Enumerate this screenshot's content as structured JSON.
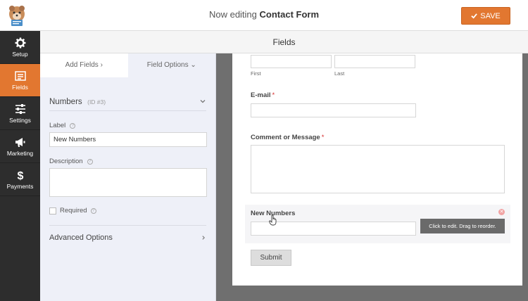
{
  "header": {
    "title_prefix": "Now editing",
    "form_name": "Contact Form",
    "save_label": "SAVE"
  },
  "sidebar": {
    "items": [
      {
        "label": "Setup",
        "icon": "gear-icon",
        "active": false
      },
      {
        "label": "Fields",
        "icon": "list-icon",
        "active": true
      },
      {
        "label": "Settings",
        "icon": "sliders-icon",
        "active": false
      },
      {
        "label": "Marketing",
        "icon": "megaphone-icon",
        "active": false
      },
      {
        "label": "Payments",
        "icon": "dollar-icon",
        "active": false
      }
    ]
  },
  "section_title": "Fields",
  "panel": {
    "tabs": [
      {
        "label": "Add Fields ›"
      },
      {
        "label": "Field Options ⌄"
      }
    ],
    "field_name": "Numbers",
    "field_id": "(ID #3)",
    "label_caption": "Label",
    "label_value": "New Numbers",
    "description_caption": "Description",
    "required_caption": "Required",
    "advanced_caption": "Advanced Options"
  },
  "preview": {
    "first_caption": "First",
    "last_caption": "Last",
    "email_label": "E-mail",
    "comment_label": "Comment or Message",
    "required_mark": "*",
    "numbers_label": "New Numbers",
    "tooltip": "Click to edit. Drag to reorder.",
    "submit_label": "Submit"
  },
  "colors": {
    "accent": "#e27730",
    "sidebar_bg": "#2d2d2d",
    "required": "#d62d2d"
  }
}
